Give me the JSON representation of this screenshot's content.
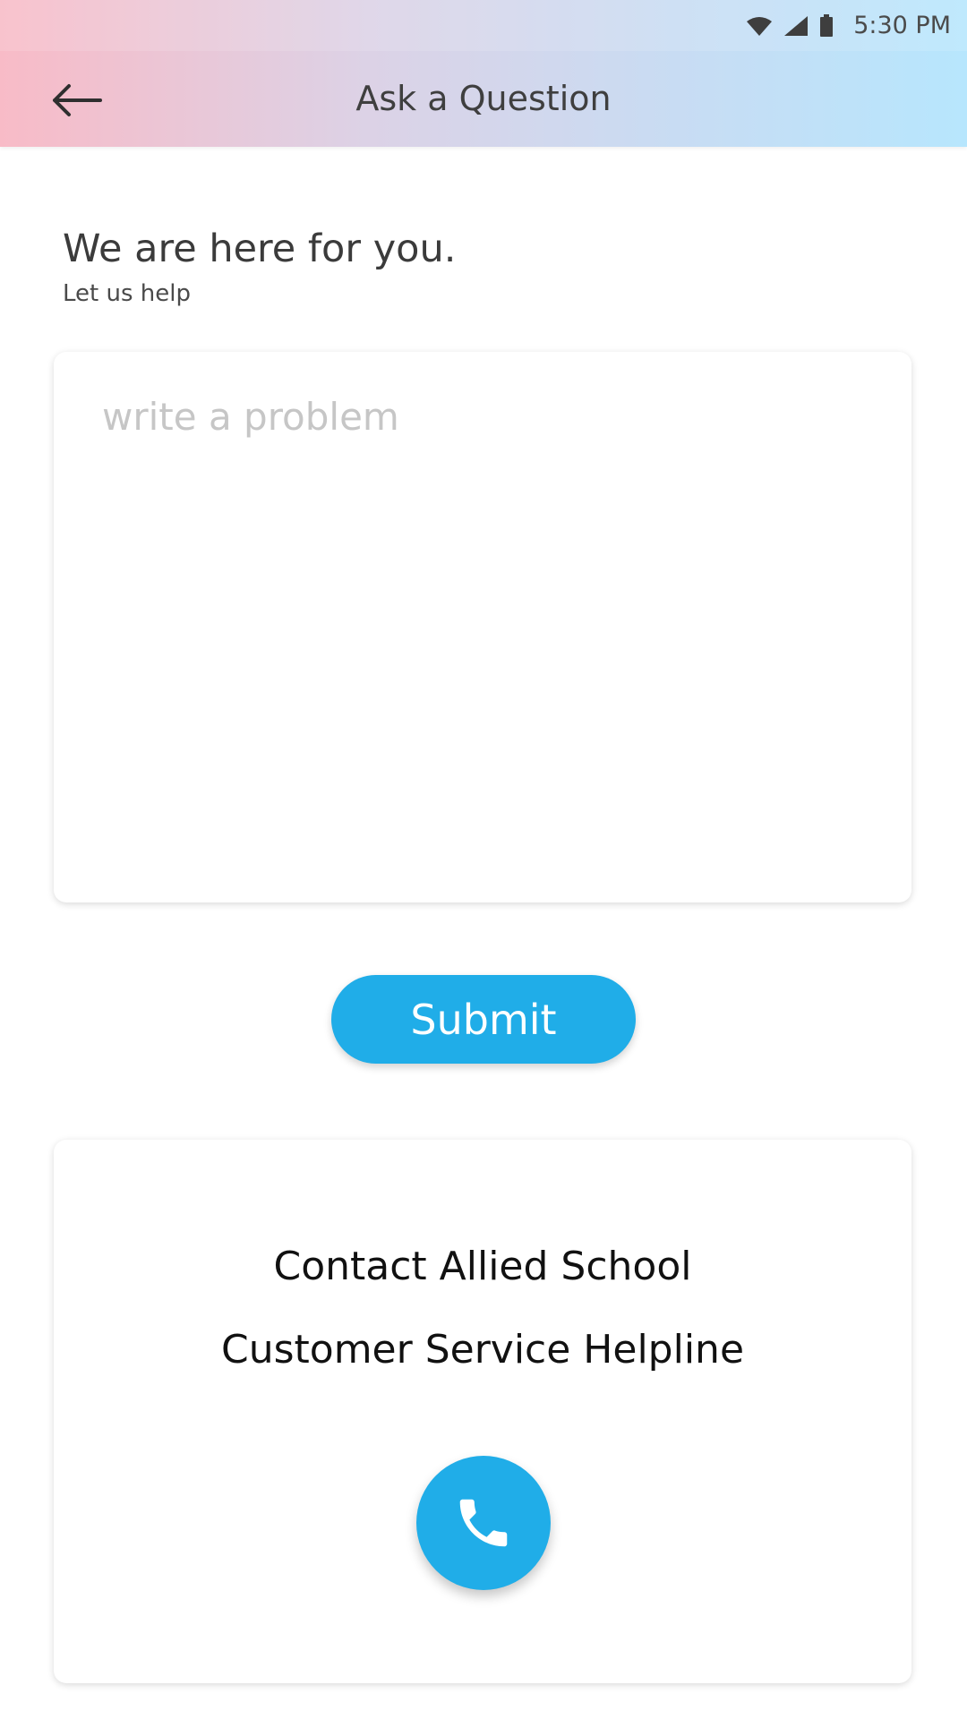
{
  "status_bar": {
    "time": "5:30 PM",
    "icons": [
      "wifi-icon",
      "signal-icon",
      "battery-icon"
    ]
  },
  "app_bar": {
    "title": "Ask a Question",
    "back_icon": "arrow-left-icon"
  },
  "intro": {
    "heading": "We are here for you.",
    "subheading": "Let us help"
  },
  "problem_form": {
    "placeholder": "write a problem",
    "value": "",
    "submit_label": "Submit"
  },
  "contact": {
    "line1": "Contact Allied School",
    "line2": "Customer Service Helpline",
    "call_icon": "phone-icon"
  },
  "colors": {
    "accent": "#20ADE8",
    "header_gradient_start": "#F8BBC7",
    "header_gradient_end": "#B7E6FD"
  }
}
